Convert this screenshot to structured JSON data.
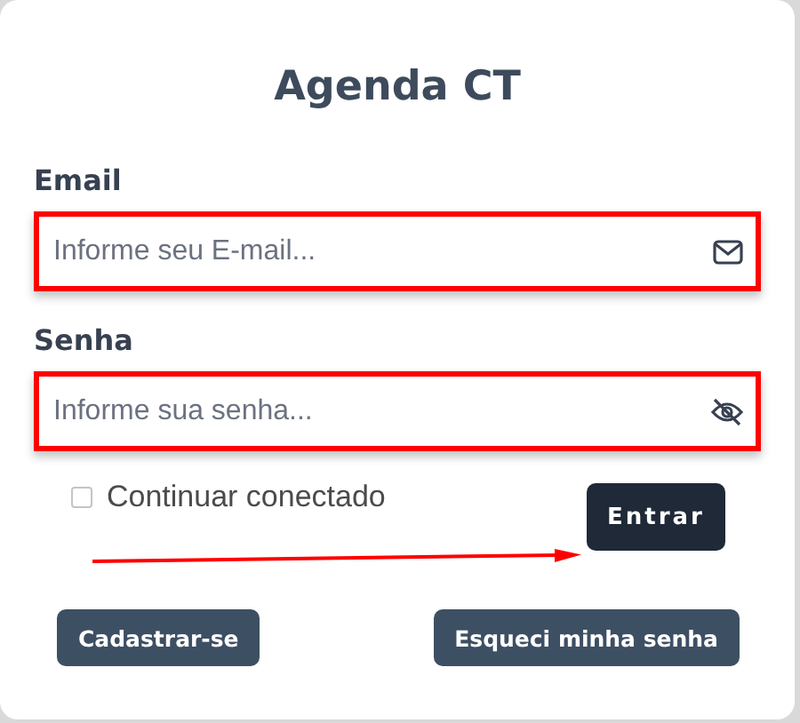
{
  "title": "Agenda CT",
  "fields": [
    {
      "label": "Email",
      "placeholder": "Informe seu E-mail...",
      "kind": "email",
      "highlighted": true
    },
    {
      "label": "Senha",
      "placeholder": "Informe sua senha...",
      "kind": "password",
      "highlighted": true
    }
  ],
  "remember": {
    "label": "Continuar conectado",
    "checked": false
  },
  "arrow": true,
  "submit": "Entrar",
  "links": [
    "Cadastrar-se",
    "Esqueci minha senha"
  ]
}
